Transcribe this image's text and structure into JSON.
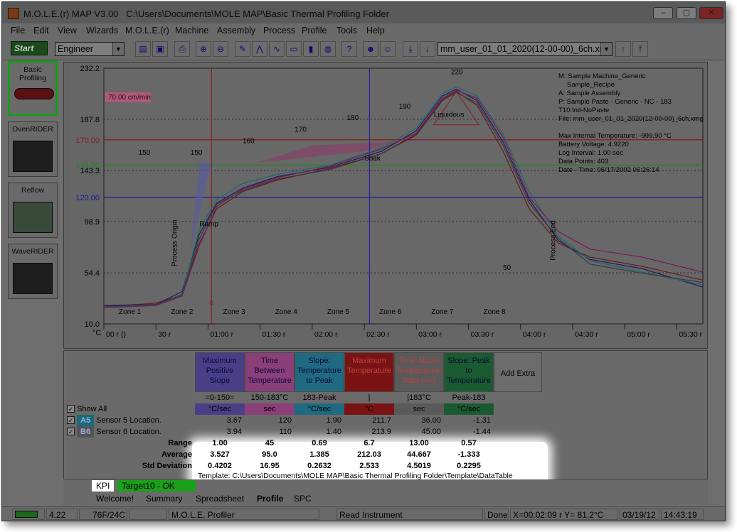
{
  "window": {
    "app": "M.O.L.E.(r) MAP V3.00",
    "path": "C:\\Users\\Documents\\MOLE MAP\\Basic Thermal Profiling Folder",
    "min": "‒",
    "max": "▢",
    "close": "✕"
  },
  "menu": [
    "File",
    "Edit",
    "View",
    "Wizards",
    "M.O.L.E.(r)",
    "Machine",
    "Assembly",
    "Process",
    "Profile",
    "Tools",
    "Help"
  ],
  "toolbar": {
    "start_label": "Start",
    "user_level": "Engineer",
    "file_combo": "mm_user_01_01_2020(12-00-00)_6ch.xr",
    "icons": [
      "folder-icon",
      "save-icon",
      "print-icon",
      "zoom-in-icon",
      "zoom-out-icon",
      "draw-icon",
      "chart-a-icon",
      "chart-b-icon",
      "ruler-icon",
      "battery-icon",
      "globe-icon",
      "help-icon",
      "person-a-icon",
      "person-b-icon",
      "arrow-down-bar-icon",
      "arrow-down-icon",
      "arrow-up-icon",
      "arrow-up-bar-icon"
    ]
  },
  "sidebar": [
    {
      "label": "Basic Profiling",
      "active": true
    },
    {
      "label": "OvenRIDER",
      "active": false
    },
    {
      "label": "Reflow",
      "active": false
    },
    {
      "label": "WaveRIDER",
      "active": false
    }
  ],
  "chart_data": {
    "type": "line",
    "xlabel": "",
    "ylabel": "°C",
    "xlim": [
      0,
      345
    ],
    "ylim": [
      10,
      232.2
    ],
    "y_ticks": [
      "232.2",
      "187.8",
      "143.3",
      "98.9",
      "54.4",
      "10.0"
    ],
    "x_ticks": [
      "00 r ()",
      "30 r",
      "01:00 r",
      "01:30 r",
      "02:00 r",
      "02:30 r",
      "03:00 r",
      "03:30 r",
      "04:00 r",
      "04:30 r",
      "05:00 r",
      "05:30 r"
    ],
    "ref_lines": [
      {
        "y": 170.0,
        "label": "170.00",
        "color": "#8a1a1a"
      },
      {
        "y": 148.0,
        "label": "148.00",
        "color": "#1a8a1a"
      },
      {
        "y": 120.0,
        "label": "120.00",
        "color": "#1a1a9a"
      }
    ],
    "cursors": [
      {
        "x": 62,
        "color": "#8a1a1a",
        "label": "0"
      },
      {
        "x": 153,
        "color": "#1a1a9a",
        "label": ""
      }
    ],
    "zones": [
      "Zone 1",
      "Zone 2",
      "Zone 3",
      "Zone 4",
      "Zone 5",
      "Zone 6",
      "Zone 7",
      "Zone 8"
    ],
    "zone_temps": [
      "150",
      "150",
      "160",
      "170",
      "180",
      "190",
      "220",
      "50"
    ],
    "speed": "70.00 cm/min",
    "annotations": [
      "Process Origin",
      "Ramp",
      "Soak",
      "Liquidous",
      "Process End"
    ],
    "info": [
      "M: Sample Machine_Generic",
      "Sample_Recipe",
      "A: Sample Assembly",
      "P: Sample Paste - Generic - NC - 183",
      "T10:Init-NoPaste",
      "File: mm_user_01_01_2020(12-00-00)_6ch.xmg",
      "Max Internal Temperature: -999.90 °C",
      "Battery Voltage: 4.9220",
      "Log Interval: 1.00 sec",
      "Data Points: 403",
      "Date - Time: 06/17/2002 06:26:14"
    ],
    "series": [
      {
        "color": "#6a1a1a",
        "values": [
          [
            0,
            25
          ],
          [
            30,
            28
          ],
          [
            45,
            35
          ],
          [
            55,
            80
          ],
          [
            65,
            110
          ],
          [
            80,
            125
          ],
          [
            100,
            135
          ],
          [
            130,
            145
          ],
          [
            160,
            158
          ],
          [
            180,
            175
          ],
          [
            195,
            205
          ],
          [
            203,
            212
          ],
          [
            215,
            200
          ],
          [
            230,
            160
          ],
          [
            245,
            110
          ],
          [
            262,
            80
          ],
          [
            280,
            68
          ],
          [
            310,
            60
          ],
          [
            345,
            48
          ]
        ]
      },
      {
        "color": "#1a1a6a",
        "values": [
          [
            0,
            26
          ],
          [
            30,
            27
          ],
          [
            45,
            38
          ],
          [
            55,
            88
          ],
          [
            65,
            115
          ],
          [
            80,
            128
          ],
          [
            100,
            138
          ],
          [
            130,
            146
          ],
          [
            160,
            160
          ],
          [
            180,
            178
          ],
          [
            195,
            208
          ],
          [
            203,
            214
          ],
          [
            215,
            204
          ],
          [
            230,
            168
          ],
          [
            245,
            118
          ],
          [
            262,
            82
          ],
          [
            280,
            66
          ],
          [
            310,
            58
          ],
          [
            345,
            42
          ]
        ]
      },
      {
        "color": "#1a6a6a",
        "values": [
          [
            0,
            25
          ],
          [
            30,
            26
          ],
          [
            45,
            36
          ],
          [
            55,
            92
          ],
          [
            65,
            118
          ],
          [
            80,
            132
          ],
          [
            100,
            140
          ],
          [
            130,
            148
          ],
          [
            160,
            163
          ],
          [
            180,
            180
          ],
          [
            195,
            210
          ],
          [
            203,
            216
          ],
          [
            215,
            208
          ],
          [
            230,
            175
          ],
          [
            245,
            125
          ],
          [
            262,
            86
          ],
          [
            280,
            65
          ],
          [
            310,
            55
          ],
          [
            345,
            44
          ]
        ]
      },
      {
        "color": "#7a1a5a",
        "values": [
          [
            0,
            24
          ],
          [
            30,
            26
          ],
          [
            45,
            34
          ],
          [
            55,
            78
          ],
          [
            65,
            112
          ],
          [
            80,
            127
          ],
          [
            100,
            137
          ],
          [
            130,
            147
          ],
          [
            160,
            162
          ],
          [
            180,
            176
          ],
          [
            195,
            206
          ],
          [
            203,
            213
          ],
          [
            215,
            206
          ],
          [
            230,
            172
          ],
          [
            245,
            120
          ],
          [
            262,
            90
          ],
          [
            280,
            75
          ],
          [
            310,
            68
          ],
          [
            345,
            55
          ]
        ]
      },
      {
        "color": "#3a3a3a",
        "values": [
          [
            0,
            25
          ],
          [
            30,
            27
          ],
          [
            45,
            35
          ],
          [
            55,
            84
          ],
          [
            65,
            114
          ],
          [
            80,
            126
          ],
          [
            100,
            136
          ],
          [
            130,
            144
          ],
          [
            160,
            158
          ],
          [
            180,
            174
          ],
          [
            195,
            204
          ],
          [
            203,
            211
          ],
          [
            215,
            202
          ],
          [
            230,
            165
          ],
          [
            245,
            115
          ],
          [
            262,
            84
          ],
          [
            280,
            62
          ],
          [
            310,
            54
          ],
          [
            345,
            46
          ]
        ]
      }
    ]
  },
  "kpi": {
    "columns": [
      {
        "title": "Maximum Positive Slope",
        "range": "=0-150=",
        "unit": "°C/sec",
        "bg": "#4a3f86",
        "ubg": "#4a3f86"
      },
      {
        "title": "Time Between Temperature",
        "range": "150-183°C",
        "unit": "sec",
        "bg": "#8a3f78",
        "ubg": "#8a3f78"
      },
      {
        "title": "Slope: Temperature to Peak",
        "range": "183-Peak",
        "unit": "°C/sec",
        "bg": "#1f6a80",
        "ubg": "#1f6a80"
      },
      {
        "title": "Maximum Temperature",
        "range": "|",
        "unit": "°C",
        "bg": "#7a1414",
        "ubg": "#7a1414"
      },
      {
        "title": "Time Above Temperature: Total (+/-)",
        "range": "|183°C",
        "unit": "sec",
        "bg": "#5a5a5a",
        "ubg": "#5a5a5a"
      },
      {
        "title": "Slope: Peak to Temperature",
        "range": "Peak-183",
        "unit": "°C/sec",
        "bg": "#1a5a30",
        "ubg": "#1a5a30"
      }
    ],
    "add_extra": "Add Extra",
    "show_all": "Show All",
    "sensors": [
      {
        "tag": "A5",
        "name": "Sensor 5 Location.",
        "vals": [
          "3.67",
          "120",
          "1.90",
          "211.7",
          "36.00",
          "-1.31"
        ]
      },
      {
        "tag": "B6",
        "name": "Sensor 6 Location.",
        "vals": [
          "3.94",
          "110",
          "1.40",
          "213.9",
          "45.00",
          "-1.44"
        ]
      }
    ],
    "stats": [
      {
        "label": "Range",
        "vals": [
          "1.00",
          "45",
          "0.69",
          "6.7",
          "13.00",
          "0.57"
        ]
      },
      {
        "label": "Average",
        "vals": [
          "3.527",
          "95.0",
          "1.385",
          "212.03",
          "44.667",
          "-1.333"
        ]
      },
      {
        "label": "Std Deviation",
        "vals": [
          "0.4202",
          "16.95",
          "0.2632",
          "2.533",
          "4.5019",
          "0.2295"
        ]
      }
    ],
    "template": "Template: C:\\Users\\Documents\\MOLE MAP\\Basic Thermal Profiling Folder\\Template\\DataTable"
  },
  "tabs_kpi": [
    "KPI",
    "Target10 - OK"
  ],
  "tabs_main": [
    "Welcome!",
    "Summary",
    "Spreadsheet",
    "Profile",
    "SPC"
  ],
  "status": {
    "battery": "4.22",
    "temp": "76F/24C",
    "profiler": "M.O.L.E. Profiler",
    "read": "Read Instrument",
    "done": "Done",
    "coords": "X=00:02:09 r Y= 81.2°C",
    "date": "03/19/12",
    "time": "14:43:19"
  }
}
